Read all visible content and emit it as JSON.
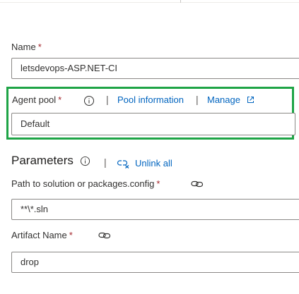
{
  "fields": {
    "name": {
      "label": "Name",
      "required_mark": "*",
      "value": "letsdevops-ASP.NET-CI"
    },
    "agent_pool": {
      "label": "Agent pool",
      "required_mark": "*",
      "separator": "|",
      "pool_info_link": "Pool information",
      "manage_link": "Manage",
      "value": "Default"
    }
  },
  "parameters": {
    "title": "Parameters",
    "separator": "|",
    "unlink_all": "Unlink all",
    "solution_path": {
      "label": "Path to solution or packages.config",
      "required_mark": "*",
      "value": "**\\*.sln"
    },
    "artifact_name": {
      "label": "Artifact Name",
      "required_mark": "*",
      "value": "drop"
    }
  },
  "colors": {
    "highlight_border": "#1ea446",
    "link": "#0064bf",
    "required": "#a4262c"
  },
  "icons": [
    "info-icon",
    "external-link-icon",
    "unlink-icon",
    "link-icon"
  ]
}
